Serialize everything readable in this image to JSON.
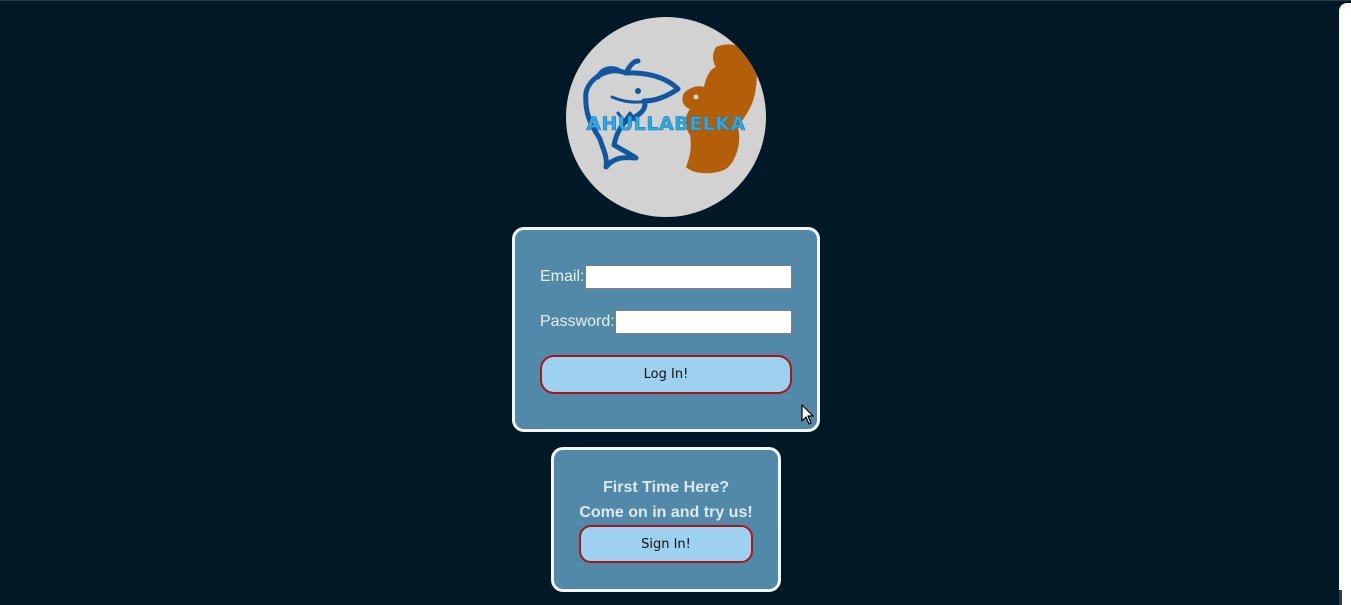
{
  "logo": {
    "text": "AHULLABELKA",
    "colors": {
      "background": "#d2d2d2",
      "shark": "#1256a0",
      "squirrel": "#b35f0a",
      "text": "#2fa8e0"
    }
  },
  "login": {
    "email_label": "Email:",
    "email_value": "",
    "password_label": "Password:",
    "password_value": "",
    "submit_label": "Log In!"
  },
  "signup": {
    "line1": "First Time Here?",
    "line2": "Come on in and try us!",
    "button_label": "Sign In!"
  },
  "colors": {
    "page_background": "#011826",
    "card_background": "#5289a8",
    "card_border": "#f3f5f6",
    "button_fill": "#9dd1ef",
    "button_border": "#a31818"
  }
}
